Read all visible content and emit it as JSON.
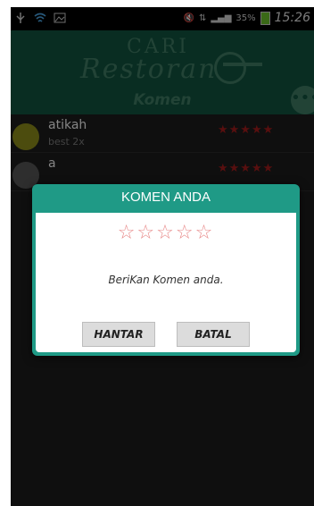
{
  "status_bar": {
    "battery": "35%",
    "time": "15:26"
  },
  "header": {
    "logo_top": "CARI",
    "logo_bottom": "Restoran",
    "title": "Komen"
  },
  "comments": [
    {
      "name": "atikah",
      "comment": "best 2x",
      "stars": "★★★★★"
    },
    {
      "name": "a",
      "comment": "",
      "stars": "★★★★★"
    }
  ],
  "dialog": {
    "title": "KOMEN ANDA",
    "rating": "☆☆☆☆☆",
    "prompt": "BeriKan Komen anda.",
    "send_label": "HANTAR",
    "cancel_label": "BATAL"
  },
  "colors": {
    "header": "#12523f",
    "dialog_accent": "#1f9a86",
    "star_filled": "#a11d1d",
    "star_empty": "#e88a8a"
  }
}
